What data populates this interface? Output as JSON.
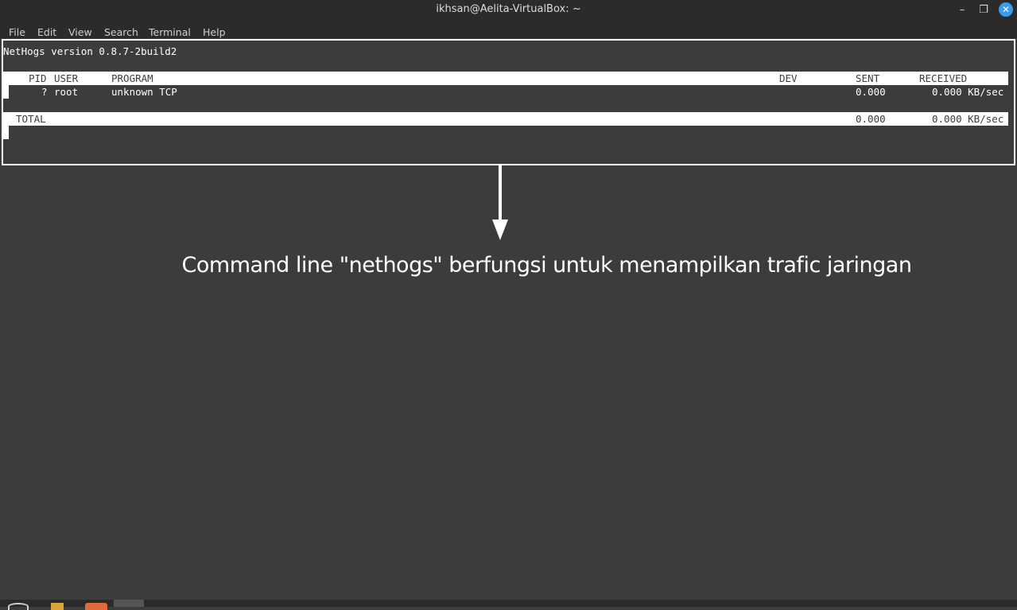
{
  "window": {
    "title": "ikhsan@Aelita-VirtualBox: ~",
    "min_symbol": "–",
    "max_symbol": "❐",
    "close_symbol": "✕"
  },
  "menubar": {
    "file": "File",
    "edit": "Edit",
    "view": "View",
    "search": "Search",
    "terminal": "Terminal",
    "help": "Help"
  },
  "nethogs": {
    "version_line": "NetHogs version 0.8.7-2build2",
    "headers": {
      "pid": "PID",
      "user": "USER",
      "program": "PROGRAM",
      "dev": "DEV",
      "sent": "SENT",
      "received": "RECEIVED"
    },
    "rows": [
      {
        "pid": "?",
        "user": "root",
        "program": "unknown TCP",
        "dev": "",
        "sent": "0.000",
        "received": "0.000 KB/sec"
      }
    ],
    "total": {
      "label": "TOTAL",
      "sent": "0.000",
      "received": "0.000 KB/sec"
    }
  },
  "annotation": {
    "caption": "Command line \"nethogs\" berfungsi untuk menampilkan trafic jaringan"
  },
  "colors": {
    "terminal_bg": "#3c3c3c",
    "titlebar_bg": "#2b2b2b",
    "close_button": "#3a9be8",
    "highlight": "#ffffff"
  }
}
